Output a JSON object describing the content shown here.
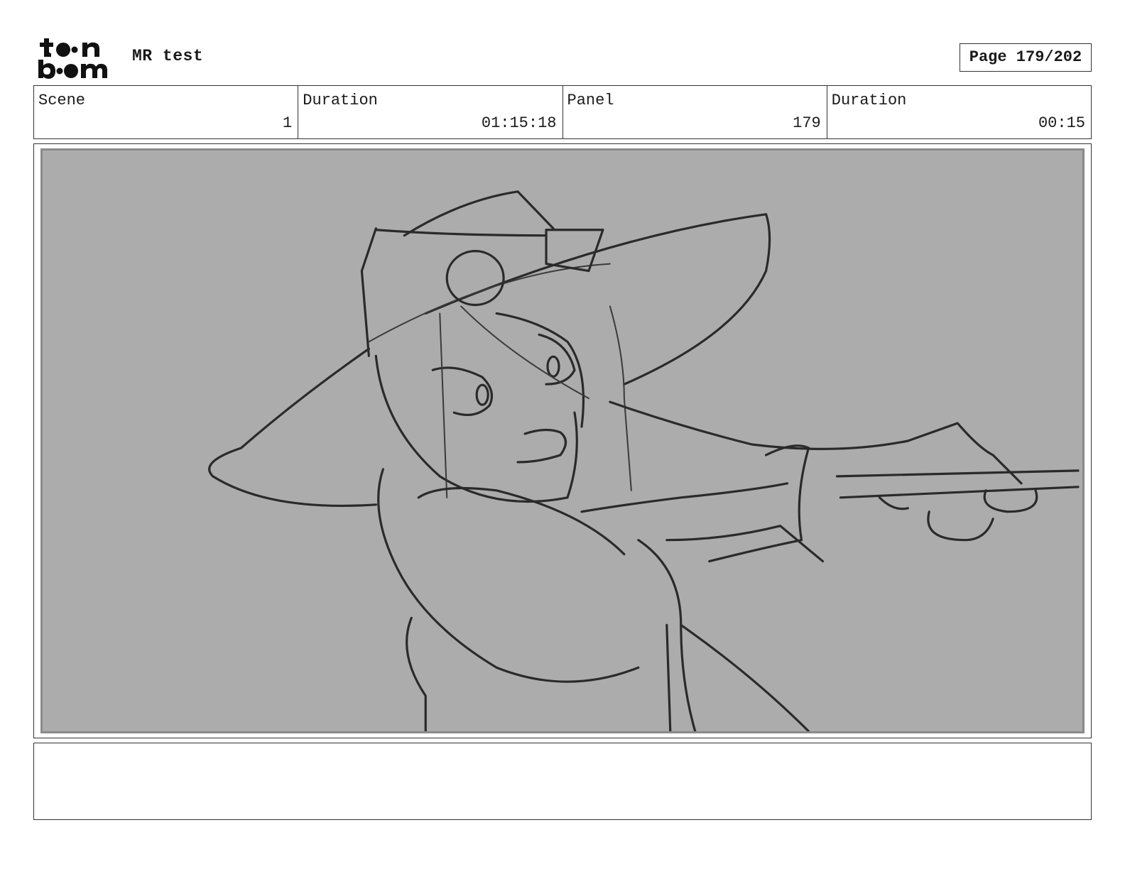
{
  "header": {
    "logo_alt": "toon boom",
    "project_title": "MR test",
    "page_counter": "Page 179/202"
  },
  "info": {
    "scene_label": "Scene",
    "scene_value": "1",
    "scene_duration_label": "Duration",
    "scene_duration_value": "01:15:18",
    "panel_label": "Panel",
    "panel_value": "179",
    "panel_duration_label": "Duration",
    "panel_duration_value": "00:15"
  },
  "notes": {
    "text": ""
  }
}
